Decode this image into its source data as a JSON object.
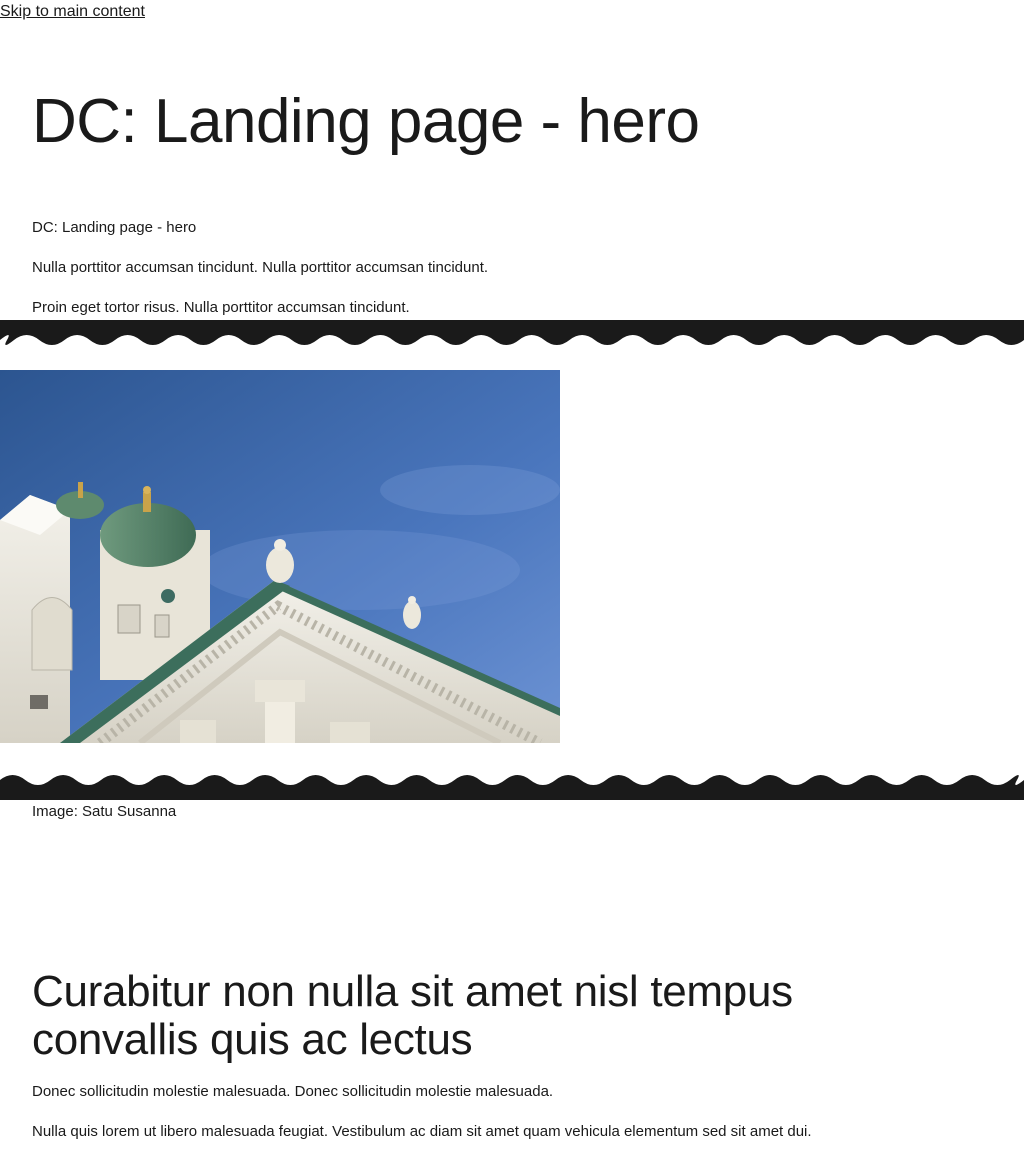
{
  "skip_link": "Skip to main content",
  "page_title": "DC: Landing page - hero",
  "lead": [
    "DC: Landing page - hero",
    "Nulla porttitor accumsan tincidunt. Nulla porttitor accumsan tincidunt.",
    "Proin eget tortor risus. Nulla porttitor accumsan tincidunt."
  ],
  "hero": {
    "caption": "Image: Satu Susanna",
    "koro_color": "#1a1a1a"
  },
  "section": {
    "title": "Curabitur non nulla sit amet nisl tempus convallis quis ac lectus",
    "paragraphs": [
      "Donec sollicitudin molestie malesuada. Donec sollicitudin molestie malesuada.",
      "Nulla quis lorem ut libero malesuada feugiat. Vestibulum ac diam sit amet quam vehicula elementum sed sit amet dui."
    ]
  }
}
